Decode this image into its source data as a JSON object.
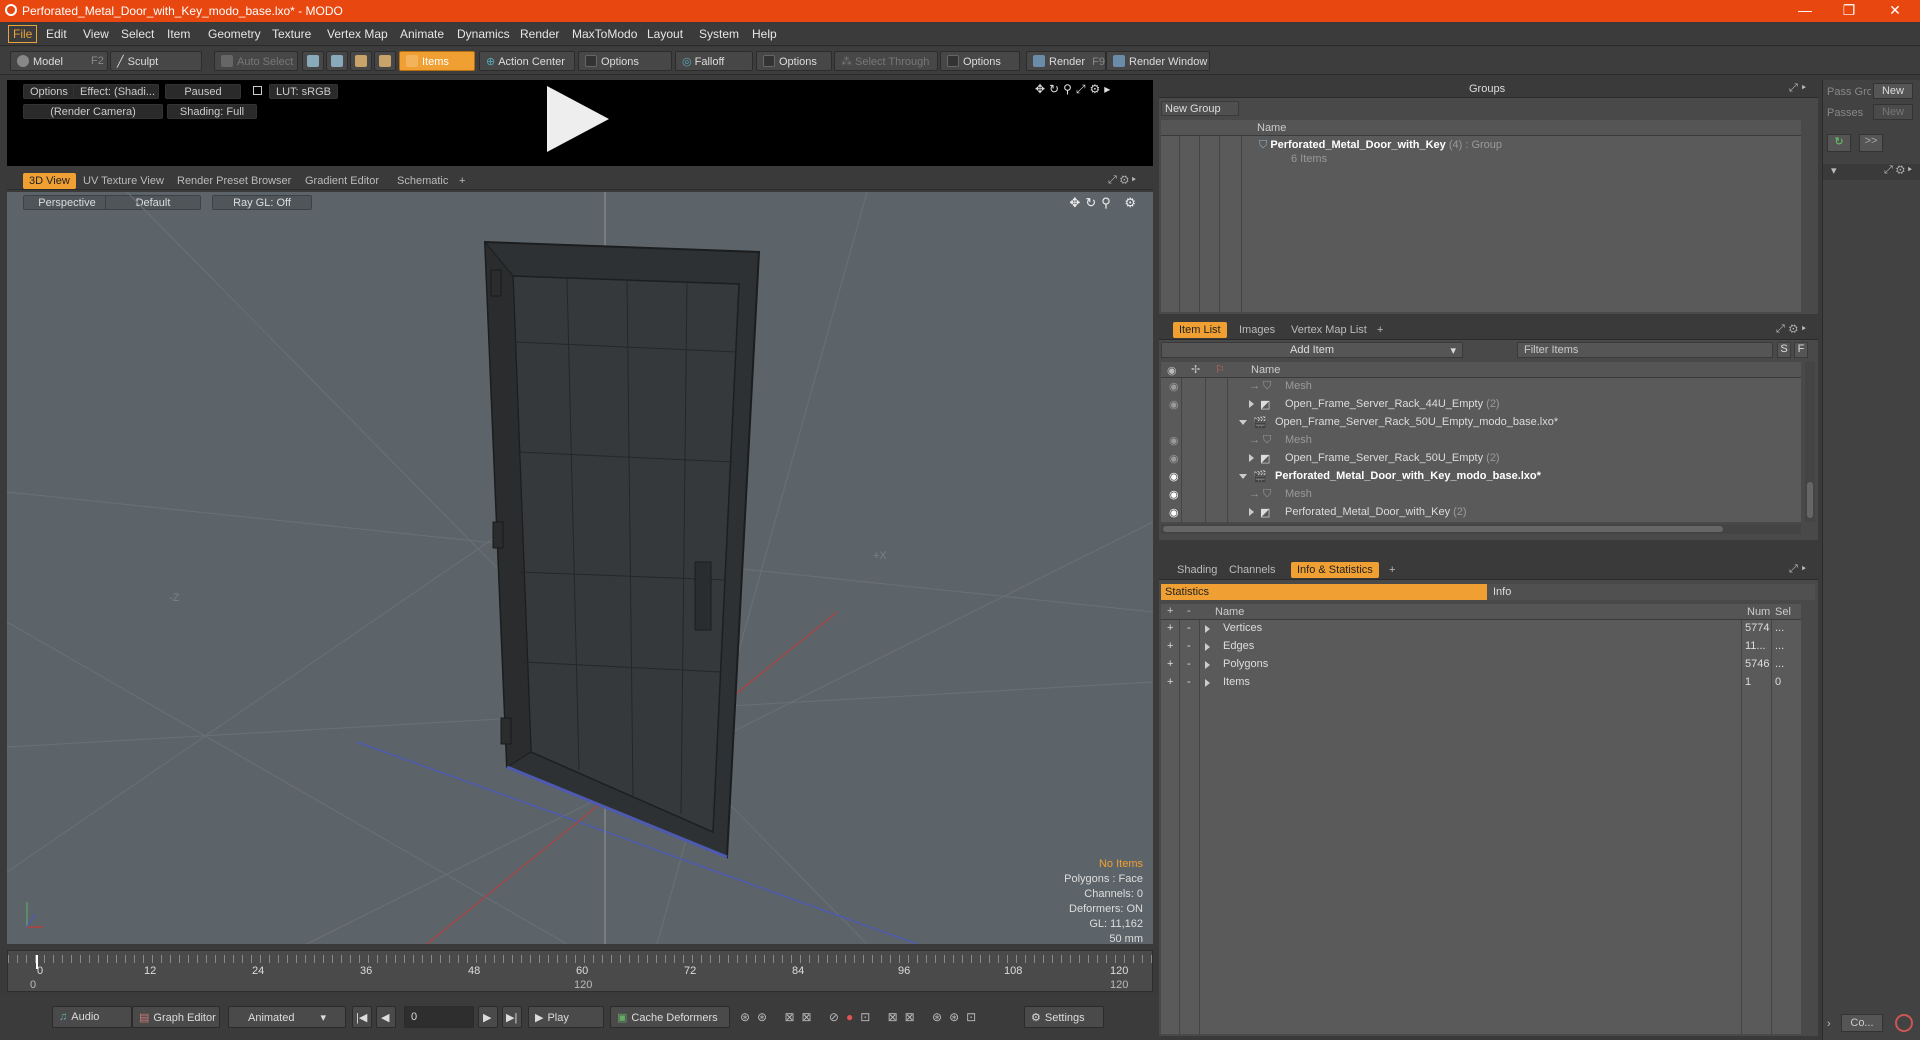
{
  "window": {
    "title": "Perforated_Metal_Door_with_Key_modo_base.lxo* - MODO"
  },
  "menu": [
    "File",
    "Edit",
    "View",
    "Select",
    "Item",
    "Geometry",
    "Texture",
    "Vertex Map",
    "Animate",
    "Dynamics",
    "Render",
    "MaxToModo",
    "Layout",
    "System",
    "Help"
  ],
  "toolbar": {
    "model": "Model",
    "model_key": "F2",
    "sculpt": "Sculpt",
    "auto_select": "Auto Select",
    "items": "Items",
    "action_center": "Action Center",
    "options1": "Options",
    "falloff": "Falloff",
    "options2": "Options",
    "select_through": "Select Through",
    "options3": "Options",
    "render": "Render",
    "render_key": "F9",
    "render_window": "Render Window"
  },
  "preview": {
    "options": "Options",
    "effect": "Effect: (Shadi...",
    "paused": "Paused",
    "lut": "LUT: sRGB",
    "camera": "(Render Camera)",
    "shading": "Shading: Full"
  },
  "view_tabs": [
    "3D View",
    "UV Texture View",
    "Render Preset Browser",
    "Gradient Editor",
    "Schematic"
  ],
  "viewport": {
    "perspective": "Perspective",
    "default": "Default",
    "raygl": "Ray GL: Off",
    "stats": {
      "no_items": "No Items",
      "polygons": "Polygons : Face",
      "channels": "Channels: 0",
      "deformers": "Deformers: ON",
      "gl": "GL: 11,162",
      "mm": "50 mm"
    },
    "axis_x_label": "+X",
    "axis_z_label": "-Z"
  },
  "timeline": {
    "ticks": [
      "0",
      "12",
      "24",
      "36",
      "48",
      "60",
      "72",
      "84",
      "96",
      "108",
      "120"
    ],
    "start": "0",
    "mid": "120",
    "end": "120"
  },
  "bottom": {
    "audio": "Audio",
    "graph_editor": "Graph Editor",
    "animated": "Animated",
    "frame": "0",
    "play": "Play",
    "cache": "Cache Deformers",
    "settings": "Settings"
  },
  "groups": {
    "title": "Groups",
    "new_group": "New Group",
    "name_col": "Name",
    "item_name": "Perforated_Metal_Door_with_Key",
    "item_count": "(4)",
    "item_type": ": Group",
    "item_sub": "6 Items"
  },
  "passes": {
    "pass_label": "Pass Gro",
    "new1": "New",
    "passes_label": "Passes",
    "new2": "New",
    "arrow_btn": ">>"
  },
  "item_list": {
    "tabs": [
      "Item List",
      "Images",
      "Vertex Map List"
    ],
    "add_item": "Add Item",
    "filter": "Filter Items",
    "s": "S",
    "f": "F",
    "name_col": "Name",
    "rows": [
      {
        "text": "Mesh",
        "dim": true,
        "indent": 3
      },
      {
        "text": "Open_Frame_Server_Rack_44U_Empty",
        "count": "(2)",
        "indent": 2
      },
      {
        "text": "Open_Frame_Server_Rack_50U_Empty_modo_base.lxo*",
        "indent": 1
      },
      {
        "text": "Mesh",
        "dim": true,
        "indent": 3
      },
      {
        "text": "Open_Frame_Server_Rack_50U_Empty",
        "count": "(2)",
        "indent": 2
      },
      {
        "text": "Perforated_Metal_Door_with_Key_modo_base.lxo*",
        "bold": true,
        "indent": 1
      },
      {
        "text": "Mesh",
        "dim": true,
        "indent": 3
      },
      {
        "text": "Perforated_Metal_Door_with_Key",
        "count": "(2)",
        "indent": 2
      }
    ]
  },
  "info": {
    "tabs": [
      "Shading",
      "Channels",
      "Info & Statistics"
    ],
    "statistics": "Statistics",
    "info": "Info",
    "cols": {
      "name": "Name",
      "num": "Num",
      "sel": "Sel"
    },
    "rows": [
      {
        "name": "Vertices",
        "num": "5774",
        "sel": "..."
      },
      {
        "name": "Edges",
        "num": "11...",
        "sel": "..."
      },
      {
        "name": "Polygons",
        "num": "5746",
        "sel": "..."
      },
      {
        "name": "Items",
        "num": "1",
        "sel": "0"
      }
    ]
  },
  "far_right": {
    "co": "Co..."
  }
}
